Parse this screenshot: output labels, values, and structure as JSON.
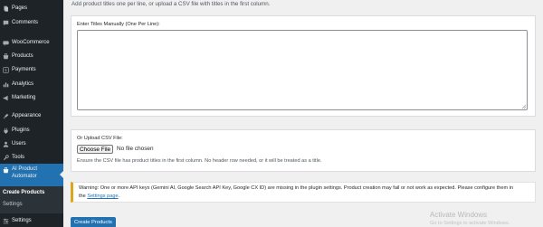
{
  "sidebar": {
    "items": [
      {
        "label": "Pages",
        "icon": "pages-icon"
      },
      {
        "label": "Comments",
        "icon": "comments-icon"
      },
      {
        "label": "WooCommerce",
        "icon": "woocommerce-icon"
      },
      {
        "label": "Products",
        "icon": "products-icon"
      },
      {
        "label": "Payments",
        "icon": "payments-icon"
      },
      {
        "label": "Analytics",
        "icon": "analytics-icon"
      },
      {
        "label": "Marketing",
        "icon": "marketing-icon"
      },
      {
        "label": "Appearance",
        "icon": "appearance-icon"
      },
      {
        "label": "Plugins",
        "icon": "plugins-icon"
      },
      {
        "label": "Users",
        "icon": "users-icon"
      },
      {
        "label": "Tools",
        "icon": "tools-icon"
      },
      {
        "label": "AI Product Automator",
        "icon": "ai-product-automator-icon"
      },
      {
        "label": "Settings",
        "icon": "settings-icon"
      }
    ],
    "submenu": [
      {
        "label": "Create Products"
      },
      {
        "label": "Settings"
      }
    ]
  },
  "main": {
    "intro": "Add product titles one per line, or upload a CSV file with titles in the first column.",
    "titles_label": "Enter Titles Manually (One Per Line):",
    "titles_value": "",
    "csv_label": "Or Upload CSV File:",
    "file_button": "Choose File",
    "file_status": "No file chosen",
    "csv_help": "Ensure the CSV file has product titles in the first column. No header row needed, or it will be treated as a title.",
    "notice_line1": "Warning: One or more API keys (Gemini AI, Google Search API Key, Google CX ID) are missing in the plugin settings. Product creation may fail or not work as expected. Please configure them in",
    "notice_the": "the",
    "notice_link": "Settings page",
    "notice_end": ".",
    "create_button": "Create Products"
  },
  "watermark": {
    "title": "Activate Windows",
    "subtitle": "Go to Settings to activate Windows."
  },
  "colors": {
    "sidebar_bg": "#1d2327",
    "accent": "#2271b1",
    "warning": "#dba617"
  }
}
